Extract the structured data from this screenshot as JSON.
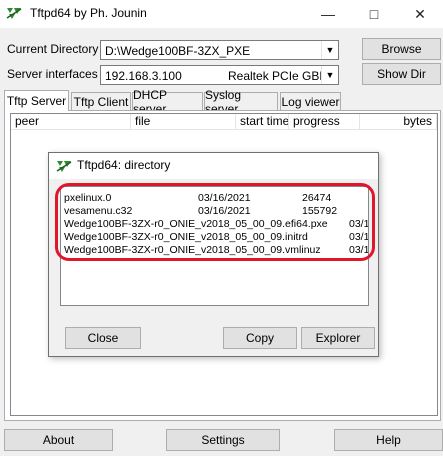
{
  "window": {
    "title": "Tftpd64 by Ph. Jounin"
  },
  "controls": {
    "current_directory_label": "Current Directory",
    "current_directory_value": "D:\\Wedge100BF-3ZX_PXE",
    "server_interfaces_label": "Server interfaces",
    "server_interface_ip": "192.168.3.100",
    "server_interface_name": "Realtek PCIe GBE I",
    "browse_label": "Browse",
    "show_dir_label": "Show Dir"
  },
  "tabs": [
    {
      "label": "Tftp Server"
    },
    {
      "label": "Tftp Client"
    },
    {
      "label": "DHCP server"
    },
    {
      "label": "Syslog server"
    },
    {
      "label": "Log viewer"
    }
  ],
  "transfer_columns": [
    "peer",
    "file",
    "start time",
    "progress",
    "bytes"
  ],
  "bottom_buttons": {
    "about": "About",
    "settings": "Settings",
    "help": "Help"
  },
  "dialog": {
    "title": "Tftpd64: directory",
    "entries": [
      {
        "name": "pxelinux.0",
        "date": "03/16/2021",
        "size": "26474"
      },
      {
        "name": "vesamenu.c32",
        "date": "03/16/2021",
        "size": "155792"
      },
      {
        "name": "Wedge100BF-3ZX-r0_ONIE_v2018_05_00_09.efi64.pxe",
        "date": "03/1",
        "size": ""
      },
      {
        "name": "Wedge100BF-3ZX-r0_ONIE_v2018_05_00_09.initrd",
        "date": "03/1",
        "size": ""
      },
      {
        "name": "Wedge100BF-3ZX-r0_ONIE_v2018_05_00_09.vmlinuz",
        "date": "03/1",
        "size": ""
      }
    ],
    "close_label": "Close",
    "copy_label": "Copy",
    "explorer_label": "Explorer"
  },
  "colors": {
    "highlight": "#e0162b",
    "icon_green": "#2e8b2e"
  }
}
